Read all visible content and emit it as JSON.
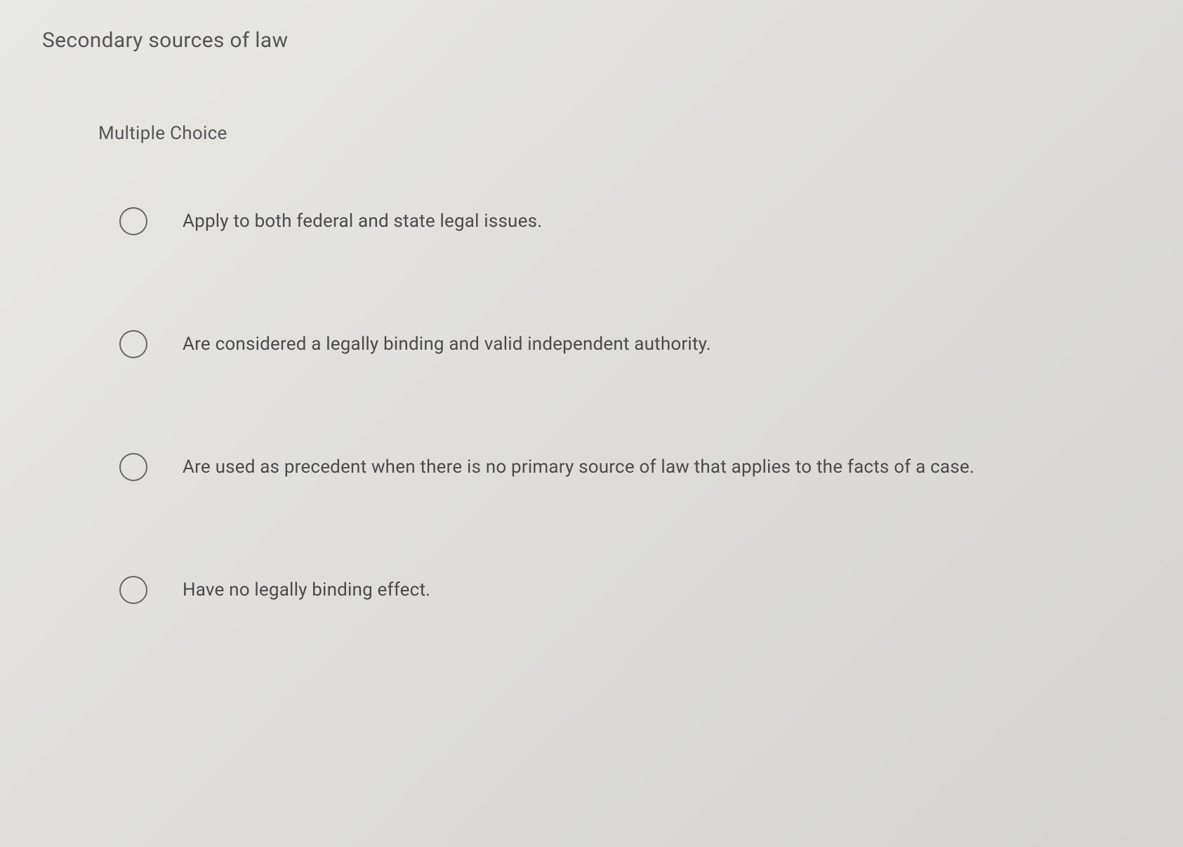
{
  "question": {
    "title": "Secondary sources of law",
    "type": "Multiple Choice",
    "options": [
      {
        "label": "Apply to both federal and state legal issues."
      },
      {
        "label": "Are considered a legally binding and valid independent authority."
      },
      {
        "label": "Are used as precedent when there is no primary source of law that applies to the facts of a case."
      },
      {
        "label": "Have no legally binding effect."
      }
    ]
  }
}
